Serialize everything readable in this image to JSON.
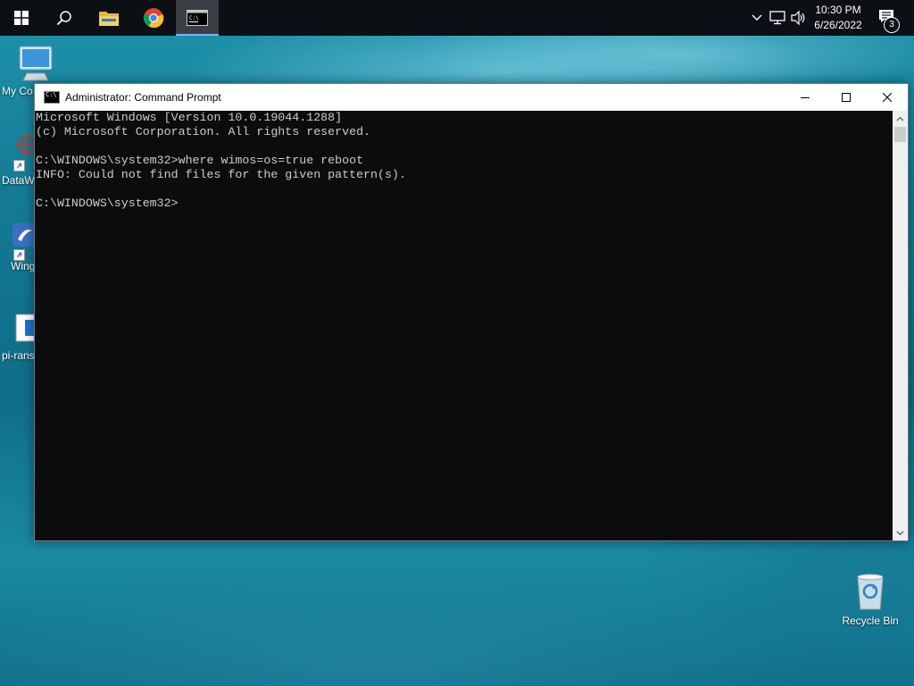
{
  "taskbar": {
    "start_icon": "windows-logo-icon",
    "search_icon": "search-icon",
    "pinned": [
      {
        "name": "file-explorer-icon"
      },
      {
        "name": "chrome-icon"
      },
      {
        "name": "command-prompt-icon",
        "active": true
      }
    ],
    "tray": {
      "chevron_icon": "chevron-up-icon",
      "network_icon": "network-icon",
      "volume_icon": "volume-icon",
      "time": "10:30 PM",
      "date": "6/26/2022",
      "notification_icon": "action-center-icon",
      "notification_count": "3"
    }
  },
  "desktop": {
    "icons": [
      {
        "label": "My Co",
        "icon": "computer-icon"
      },
      {
        "label": "DataW",
        "icon": "database-icon"
      },
      {
        "label": "Wing",
        "icon": "wing-ide-icon"
      },
      {
        "label": "pi-rans",
        "icon": "file-icon"
      },
      {
        "label": "Recycle Bin",
        "icon": "recycle-bin-icon"
      }
    ]
  },
  "cmd_window": {
    "title": "Administrator: Command Prompt",
    "minimize_icon": "minimize-icon",
    "maximize_icon": "maximize-icon",
    "close_icon": "close-icon",
    "lines": [
      "Microsoft Windows [Version 10.0.19044.1288]",
      "(c) Microsoft Corporation. All rights reserved.",
      "",
      "C:\\WINDOWS\\system32>where wimos=os=true reboot",
      "INFO: Could not find files for the given pattern(s).",
      "",
      "C:\\WINDOWS\\system32>"
    ]
  },
  "colors": {
    "taskbar_bg": "#0c0f14",
    "console_bg": "#0c0c0c",
    "console_text": "#cccccc",
    "active_indicator": "#7fb4e8"
  }
}
